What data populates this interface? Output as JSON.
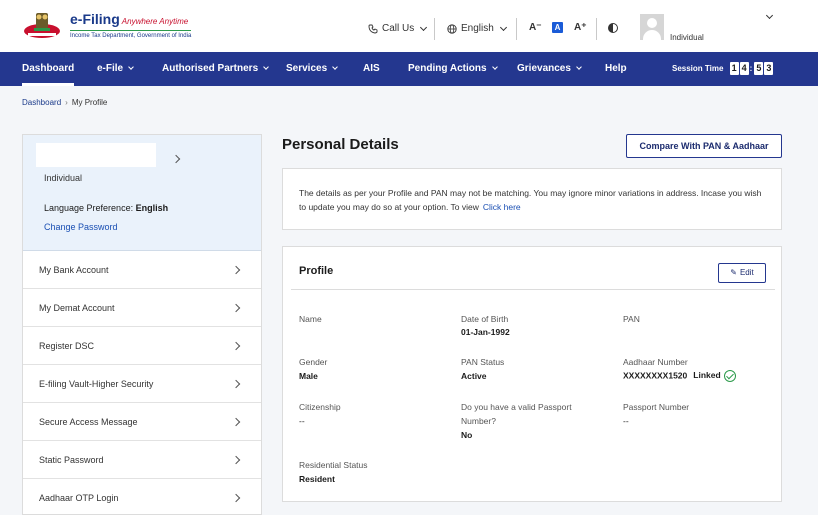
{
  "header": {
    "logo_title": "e-Filing",
    "logo_tagline": "Anywhere Anytime",
    "logo_subtitle": "Income Tax Department, Government of India",
    "call_us": "Call Us",
    "language": "English",
    "font_decrease": "A⁻",
    "font_normal": "A",
    "font_increase": "A⁺",
    "user_type": "Individual",
    "icons": [
      "phone-icon",
      "globe-icon",
      "contrast-icon",
      "avatar-icon"
    ]
  },
  "nav": {
    "items": [
      {
        "label": "Dashboard",
        "dropdown": false
      },
      {
        "label": "e-File",
        "dropdown": true
      },
      {
        "label": "Authorised Partners",
        "dropdown": true
      },
      {
        "label": "Services",
        "dropdown": true
      },
      {
        "label": "AIS",
        "dropdown": false
      },
      {
        "label": "Pending Actions",
        "dropdown": true
      },
      {
        "label": "Grievances",
        "dropdown": true
      },
      {
        "label": "Help",
        "dropdown": false
      }
    ],
    "session_label": "Session Time",
    "session_digits": [
      "1",
      "4",
      "5",
      "3"
    ],
    "active_color": "#24378f"
  },
  "breadcrumb": {
    "home": "Dashboard",
    "current": "My Profile"
  },
  "sidebar": {
    "user_type": "Individual",
    "language_label": "Language Preference:",
    "language_value": "English",
    "change_password": "Change Password",
    "items": [
      {
        "label": "My Bank Account"
      },
      {
        "label": "My Demat Account"
      },
      {
        "label": "Register DSC"
      },
      {
        "label": "E-filing Vault-Higher Security"
      },
      {
        "label": "Secure Access Message"
      },
      {
        "label": "Static Password"
      },
      {
        "label": "Aadhaar OTP Login"
      }
    ]
  },
  "main": {
    "title": "Personal Details",
    "compare_button": "Compare With PAN & Aadhaar",
    "notice_text": "The details as per your Profile and PAN may not be matching. You may ignore minor variations in address. Incase you wish to update you may do so at your option. To view",
    "notice_link": "Click here",
    "profile": {
      "title": "Profile",
      "edit_label": "Edit",
      "fields": {
        "name_label": "Name",
        "name_value": "",
        "dob_label": "Date of Birth",
        "dob_value": "01-Jan-1992",
        "pan_label": "PAN",
        "pan_value": "",
        "gender_label": "Gender",
        "gender_value": "Male",
        "pan_status_label": "PAN Status",
        "pan_status_value": "Active",
        "aadhaar_label": "Aadhaar Number",
        "aadhaar_value": "XXXXXXXX1520",
        "aadhaar_status": "Linked",
        "citizenship_label": "Citizenship",
        "citizenship_value": "--",
        "passport_q_line1": "Do you have a valid Passport",
        "passport_q_line2": "Number?",
        "passport_q_value": "No",
        "passport_no_label": "Passport Number",
        "passport_no_value": "--",
        "residential_label": "Residential Status",
        "residential_value": "Resident"
      }
    }
  }
}
